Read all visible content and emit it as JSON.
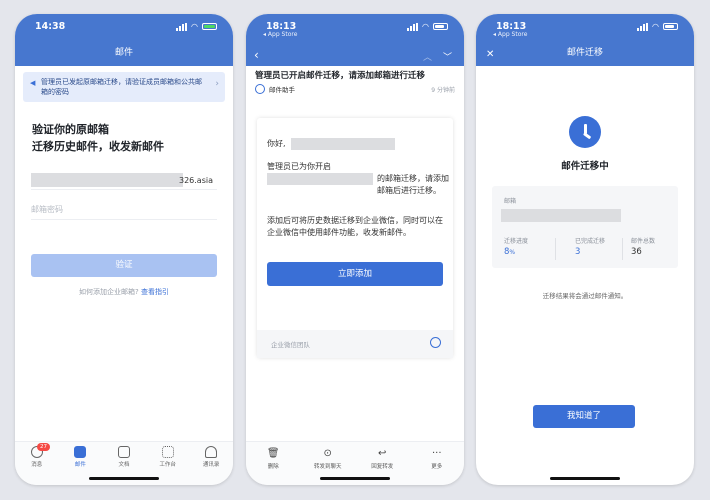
{
  "phone1": {
    "time": "14:38",
    "title": "邮件",
    "banner": "管理员已发起原邮箱迁移，请验证成员邮箱和公共邮箱的密码",
    "heading_line1": "验证你的原邮箱",
    "heading_line2": "迁移历史邮件，收发新邮件",
    "email_suffix": "326.asia",
    "password_placeholder": "邮箱密码",
    "verify_button": "验证",
    "help_text": "如何添加企业邮箱?",
    "help_link": "查看指引",
    "tabs": [
      {
        "label": "消息",
        "badge": "27"
      },
      {
        "label": "邮件"
      },
      {
        "label": "文档"
      },
      {
        "label": "工作台"
      },
      {
        "label": "通讯录"
      }
    ],
    "active_color": "#3a6fd6"
  },
  "phone2": {
    "time": "18:13",
    "back_app": "◂ App Store",
    "subject": "管理员已开启邮件迁移，请添加邮箱进行迁移",
    "sender": "邮件助手",
    "time_ago": "9 分钟前",
    "greeting": "你好,",
    "body1_pre": "管理员已为你开启",
    "body1_post": "的邮箱迁移，请添加邮箱后进行迁移。",
    "body2": "添加后可将历史数据迁移到企业微信，同时可以在企业微信中使用邮件功能，收发新邮件。",
    "add_button": "立即添加",
    "footer": "企业微信团队",
    "tools": [
      {
        "label": "删除",
        "icon": "trash-icon"
      },
      {
        "label": "转发到聊天",
        "icon": "forward-chat-icon"
      },
      {
        "label": "回复转发",
        "icon": "reply-icon"
      },
      {
        "label": "更多",
        "icon": "more-icon"
      }
    ]
  },
  "phone3": {
    "time": "18:13",
    "back_app": "◂ App Store",
    "title": "邮件迁移",
    "status": "邮件迁移中",
    "mailbox_label": "邮箱",
    "progress_label": "迁移进度",
    "progress_value": "8",
    "progress_unit": "%",
    "done_label": "已完成迁移",
    "done_value": "3",
    "total_label": "邮件总数",
    "total_value": "36",
    "note": "迁移结果将会通过邮件通知。",
    "ok_button": "我知道了"
  },
  "colors": {
    "nav_blue": "#4777cf",
    "accent": "#3a6fd6",
    "badge_red": "#f54a45"
  }
}
